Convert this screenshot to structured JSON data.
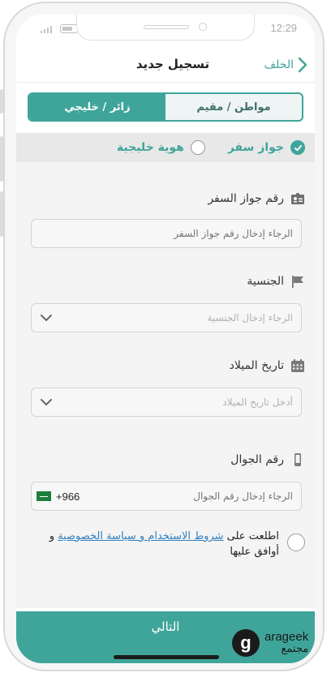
{
  "status_bar": {
    "time": "12:29"
  },
  "header": {
    "title": "تسجيل جديد",
    "back_label": "الخلف"
  },
  "tabs": [
    {
      "label": "مواطن / مقيم",
      "active": false
    },
    {
      "label": "زائر / خليجي",
      "active": true
    }
  ],
  "id_type": {
    "options": [
      {
        "label": "جواز سفر",
        "selected": true
      },
      {
        "label": "هوية خليجية",
        "selected": false
      }
    ]
  },
  "fields": {
    "passport": {
      "label": "رقم جواز السفر",
      "placeholder": "الرجاء إدخال رقم جواز السفر"
    },
    "nationality": {
      "label": "الجنسية",
      "placeholder": "الرجاء إدخال الجنسية"
    },
    "birthdate": {
      "label": "تاريخ الميلاد",
      "placeholder": "أدخل تاريخ الميلاد"
    },
    "mobile": {
      "label": "رقم الجوال",
      "placeholder": "الرجاء إدخال رقم الجوال",
      "country_code": "+966"
    }
  },
  "terms": {
    "prefix": "اطلعت على",
    "link": "شروط الاستخدام و سياسة الخصوصية",
    "suffix": "و أوافق عليها"
  },
  "next_button": "التالي",
  "watermark": {
    "line1": "arageek",
    "line2": "مجتمع"
  },
  "colors": {
    "accent": "#3fa59a",
    "link": "#2f7fbf"
  }
}
